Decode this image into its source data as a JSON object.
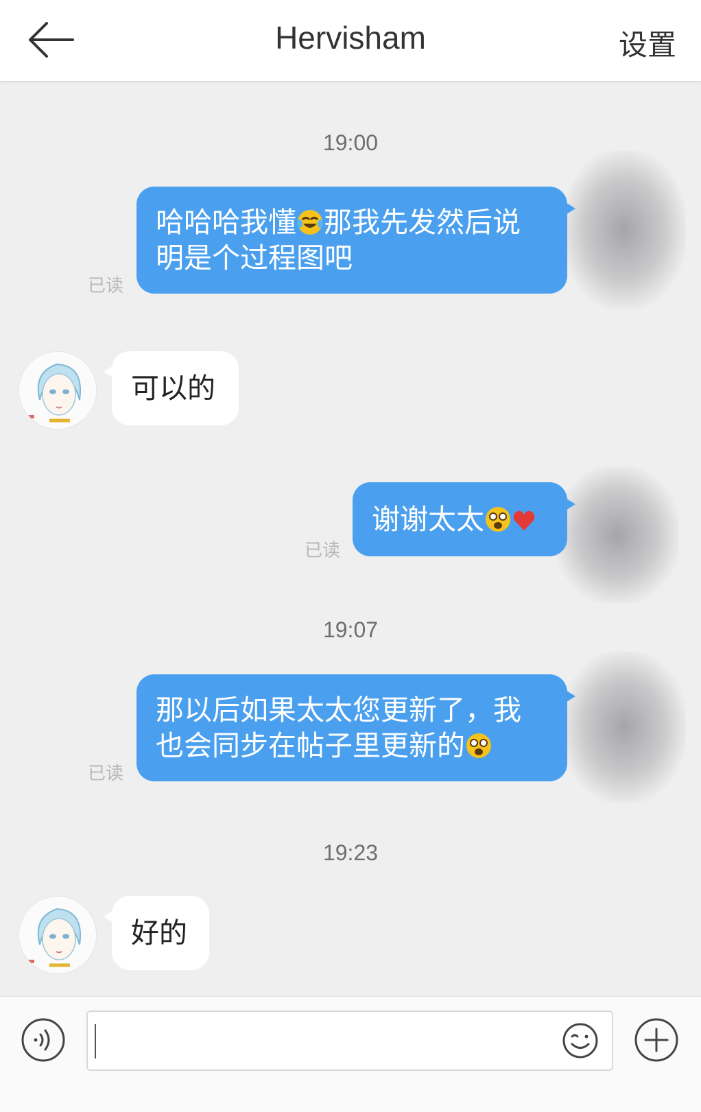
{
  "header": {
    "title": "Hervisham",
    "settings_label": "设置"
  },
  "messages": {
    "t1": "19:00",
    "m1_text_a": "哈哈哈我懂",
    "m1_text_b": "那我先发然后说",
    "m1_text_c": "明是个过程图吧",
    "m1_status": "已读",
    "m2_text": "可以的",
    "m3_text": "谢谢太太",
    "m3_status": "已读",
    "t2": "19:07",
    "m4_text_a": "那以后如果太太您更新了，我",
    "m4_text_b": "也会同步在帖子里更新的",
    "m4_status": "已读",
    "t3": "19:23",
    "m5_text": "好的"
  },
  "colors": {
    "outgoing_bubble": "#4aa0ee",
    "incoming_bubble": "#ffffff",
    "background": "#efefef"
  },
  "icons": [
    "back-arrow-icon",
    "voice-icon",
    "emoji-icon",
    "plus-icon",
    "laugh-cry-emoji",
    "shocked-emoji",
    "heart-emoji"
  ]
}
